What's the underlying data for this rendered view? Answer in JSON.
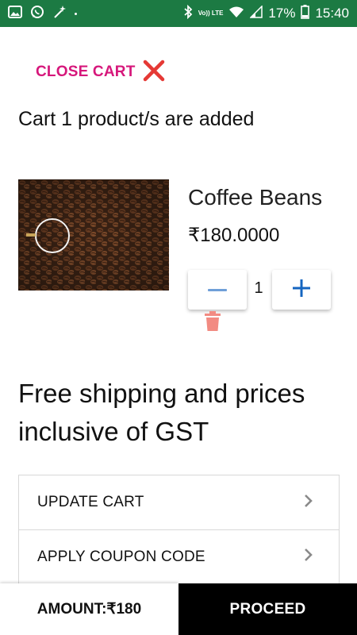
{
  "status_bar": {
    "time": "15:40",
    "battery_percent": "17%",
    "network_label": "Vo)) LTE",
    "left_icons": [
      "image-icon",
      "whatsapp-icon",
      "magic-wand-icon"
    ],
    "right_icons": [
      "bluetooth-icon",
      "wifi-icon",
      "signal-icon",
      "battery-icon"
    ],
    "background": "#1c7a43"
  },
  "cart": {
    "close_label": "CLOSE CART",
    "close_icon": "close-icon",
    "status_text": "Cart 1 product/s are added"
  },
  "product": {
    "name": "Coffee Beans",
    "price": "₹180.0000",
    "quantity": "1",
    "decrement_icon": "minus-icon",
    "increment_icon": "plus-icon",
    "delete_icon": "trash-icon"
  },
  "shipping_note": "Free shipping and prices inclusive of GST",
  "options": [
    {
      "label": "UPDATE CART",
      "icon": "chevron-right-icon"
    },
    {
      "label": "APPLY COUPON CODE",
      "icon": "chevron-right-icon"
    }
  ],
  "footer": {
    "amount_label": "AMOUNT:₹180",
    "proceed_label": "PROCEED"
  },
  "colors": {
    "accent_pink": "#d6177b",
    "close_red": "#e53935",
    "plus_blue": "#1565c0",
    "minus_blue": "#6f9fd8",
    "trash_salmon": "#f28b82"
  }
}
